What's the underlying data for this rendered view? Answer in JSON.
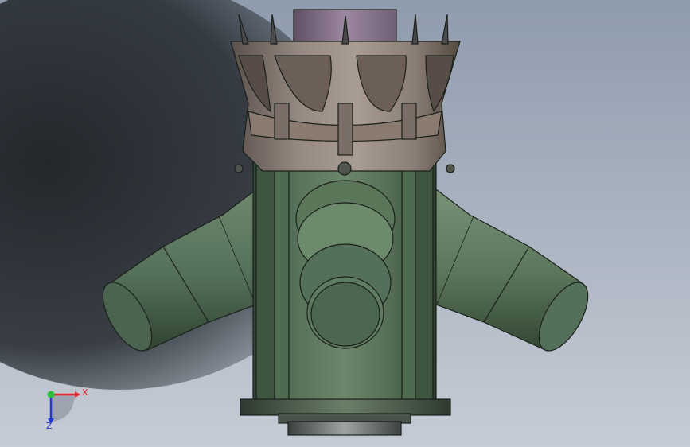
{
  "window": {
    "type": "cad-3d-viewport"
  },
  "model": {
    "description_icon": "pipe-manifold-part",
    "colors": {
      "body": "#566f56",
      "body_light": "#7d977c",
      "body_dark": "#2f4130",
      "crown": "#8d8179",
      "crown_dark": "#5b514b",
      "cap": "#8f7d91",
      "edge": "#1a1f1a"
    }
  },
  "triad": {
    "x_label": "X",
    "z_label": "Z",
    "colors": {
      "x": "#e8262a",
      "y": "#25c23d",
      "z": "#2337d6"
    }
  }
}
